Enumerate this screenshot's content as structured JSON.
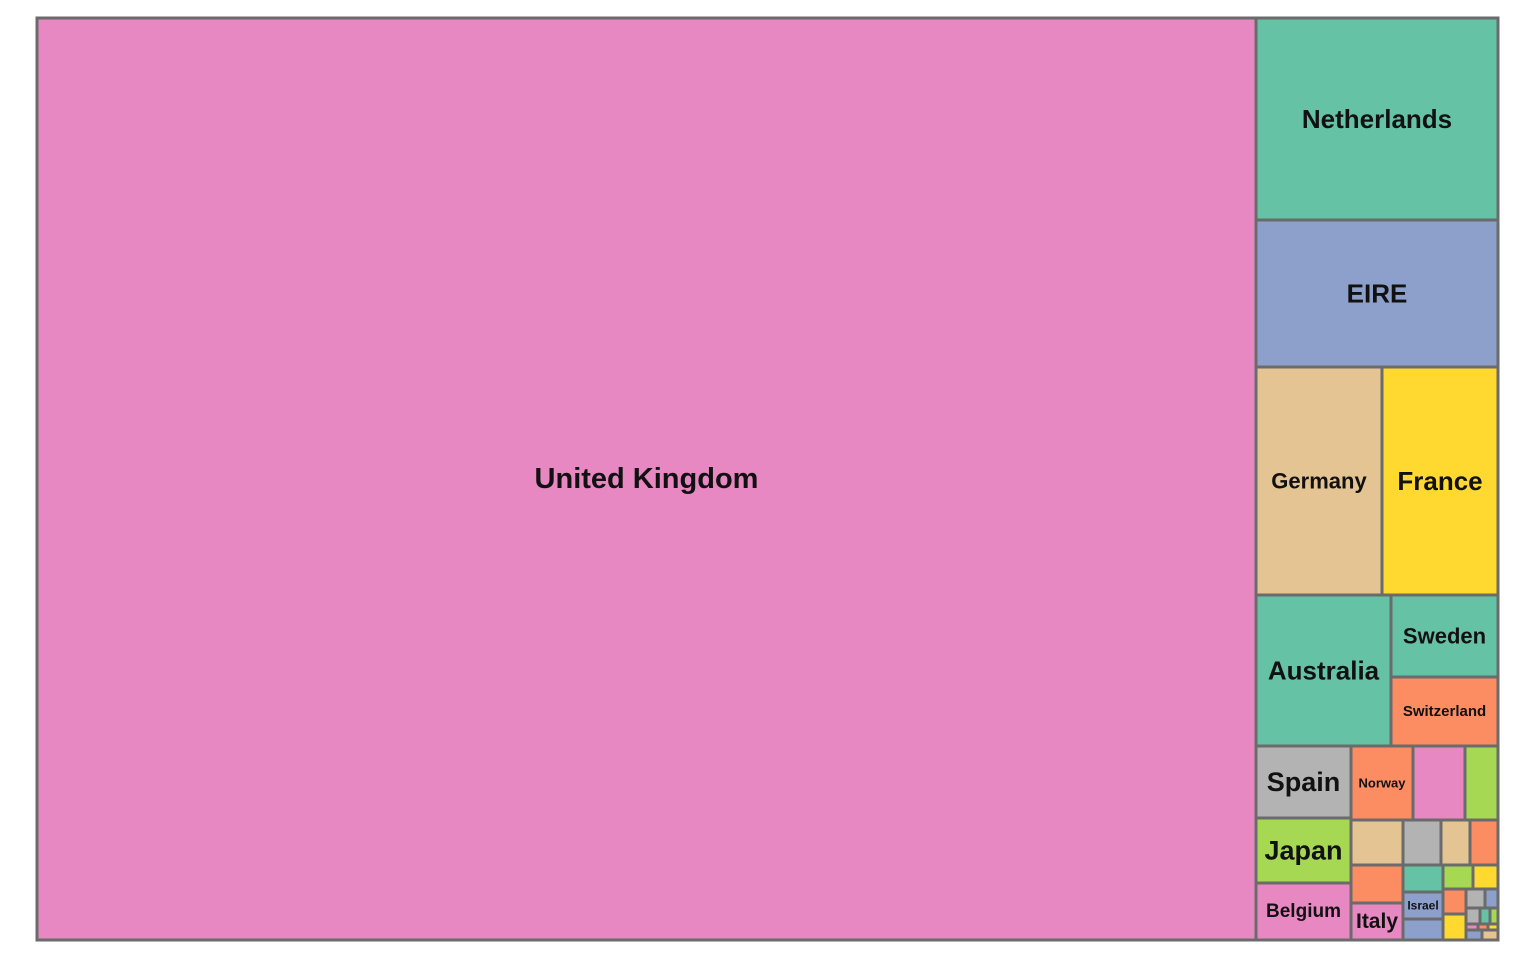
{
  "chart_data": {
    "type": "treemap",
    "title": "",
    "colors": [
      "#e788c2",
      "#66c2a5",
      "#8da0cb",
      "#e5c494",
      "#ffd92f",
      "#fc8d62",
      "#b3b3b3",
      "#a6d854"
    ],
    "items": [
      {
        "label": "United Kingdom",
        "value": 1120,
        "color": "#e788c2"
      },
      {
        "label": "Netherlands",
        "value": 48,
        "color": "#66c2a5"
      },
      {
        "label": "EIRE",
        "value": 35,
        "color": "#8da0cb"
      },
      {
        "label": "Germany",
        "value": 28.5,
        "color": "#e5c494"
      },
      {
        "label": "France",
        "value": 26.5,
        "color": "#ffd92f"
      },
      {
        "label": "Australia",
        "value": 16.5,
        "color": "#66c2a5"
      },
      {
        "label": "Sweden",
        "value": 6.3,
        "color": "#66c2a5"
      },
      {
        "label": "Switzerland",
        "value": 5.7,
        "color": "#fc8d62"
      },
      {
        "label": "Spain",
        "value": 6.6,
        "color": "#b3b3b3"
      },
      {
        "label": "Japan",
        "value": 6.2,
        "color": "#a6d854"
      },
      {
        "label": "Belgium",
        "value": 5.1,
        "color": "#e788c2"
      },
      {
        "label": "Norway",
        "value": 3.8,
        "color": "#fc8d62"
      },
      {
        "label": "",
        "value": 3.7,
        "color": "#e788c2"
      },
      {
        "label": "",
        "value": 2.3,
        "color": "#a6d854"
      },
      {
        "label": "",
        "value": 1.8,
        "color": "#e5c494"
      },
      {
        "label": "",
        "value": 1.4,
        "color": "#b3b3b3"
      },
      {
        "label": "",
        "value": 1.1,
        "color": "#e5c494"
      },
      {
        "label": "",
        "value": 1.0,
        "color": "#fc8d62"
      },
      {
        "label": "",
        "value": 1.5,
        "color": "#fc8d62"
      },
      {
        "label": "Italy",
        "value": 1.4,
        "color": "#e788c2"
      },
      {
        "label": "",
        "value": 0.9,
        "color": "#66c2a5"
      },
      {
        "label": "",
        "value": 0.6,
        "color": "#a6d854"
      },
      {
        "label": "",
        "value": 0.5,
        "color": "#ffd92f"
      },
      {
        "label": "Israel",
        "value": 0.6,
        "color": "#8da0cb"
      },
      {
        "label": "",
        "value": 0.6,
        "color": "#8da0cb"
      },
      {
        "label": "",
        "value": 0.45,
        "color": "#fc8d62"
      },
      {
        "label": "",
        "value": 0.4,
        "color": "#ffd92f"
      },
      {
        "label": "",
        "value": 0.3,
        "color": "#b3b3b3"
      },
      {
        "label": "",
        "value": 0.2,
        "color": "#8da0cb"
      },
      {
        "label": "",
        "value": 0.15,
        "color": "#b3b3b3"
      },
      {
        "label": "",
        "value": 0.12,
        "color": "#66c2a5"
      },
      {
        "label": "",
        "value": 0.1,
        "color": "#a6d854"
      },
      {
        "label": "",
        "value": 0.08,
        "color": "#e788c2"
      },
      {
        "label": "",
        "value": 0.07,
        "color": "#fc8d62"
      },
      {
        "label": "",
        "value": 0.06,
        "color": "#ffd92f"
      },
      {
        "label": "",
        "value": 0.05,
        "color": "#8da0cb"
      },
      {
        "label": "",
        "value": 0.05,
        "color": "#e5c494"
      }
    ]
  }
}
